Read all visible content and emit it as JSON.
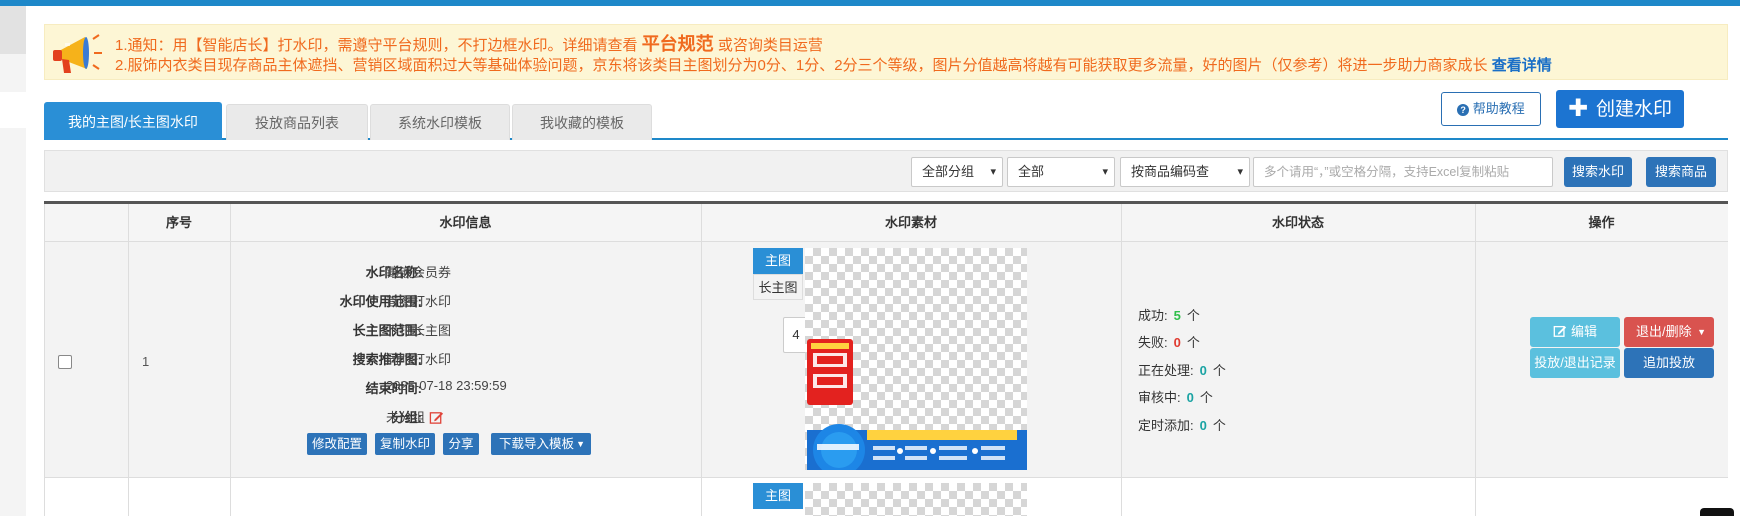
{
  "notice": {
    "l1_pre": "1.通知：用【智能店长】打水印，需遵守平台规则，不打边框水印。详细请查看",
    "l1_link": "平台规范",
    "l1_post": "或咨询类目运营",
    "l2_text": "2.服饰内衣类目现存商品主体遮挡、营销区域面积过大等基础体验问题，京东将该类目主图划分为0分、1分、2分三个等级，图片分值越高将越有可能获取更多流量，好的图片（仅参考）将进一步助力商家成长",
    "l2_link": "查看详情"
  },
  "tabs": [
    "我的主图/长主图水印",
    "投放商品列表",
    "系统水印模板",
    "我收藏的模板"
  ],
  "help_button": "帮助教程",
  "create_button": "创建水印",
  "filters": {
    "group": "全部分组",
    "scope": "全部",
    "search_type": "按商品编码查",
    "input_placeholder": "多个请用“，”或空格分隔，支持Excel复制粘贴",
    "search_watermark": "搜索水印",
    "search_goods": "搜索商品"
  },
  "table": {
    "headers": [
      "序号",
      "水印信息",
      "水印素材",
      "水印状态",
      "操作"
    ],
    "row": {
      "index": "1",
      "info_labels": [
        "水印名称:",
        "水印使用范围:",
        "长主图范围:",
        "搜索推荐图:",
        "结束时间:",
        "分组:"
      ],
      "info_values": [
        "镶嵌会员券",
        "首图打水印",
        "不打长主图",
        "同时打水印",
        "2025-07-18 23:59:59",
        "未分组"
      ],
      "actions": [
        "修改配置",
        "复制水印",
        "分享",
        "下载导入模板"
      ],
      "material_tabs": [
        "主图",
        "长主图"
      ],
      "page_badge": "4",
      "status": [
        {
          "label": "成功:",
          "count": "5",
          "unit": "个",
          "color": "#2fbf4a"
        },
        {
          "label": "失败:",
          "count": "0",
          "unit": "个",
          "color": "#e03a2f"
        },
        {
          "label": "正在处理:",
          "count": "0",
          "unit": "个",
          "color": "#1aa3a3"
        },
        {
          "label": "审核中:",
          "count": "0",
          "unit": "个",
          "color": "#1aa3a3"
        },
        {
          "label": "定时添加:",
          "count": "0",
          "unit": "个",
          "color": "#1aa3a3"
        }
      ],
      "ops": {
        "edit": "编辑",
        "exit_delete": "退出/删除",
        "records": "投放/退出记录",
        "add_deploy": "追加投放"
      }
    },
    "row2_tab": "主图"
  },
  "colors": {
    "accent": "#2a8fd6",
    "notice_text": "#f06a1e",
    "link": "#1a6fc7"
  }
}
